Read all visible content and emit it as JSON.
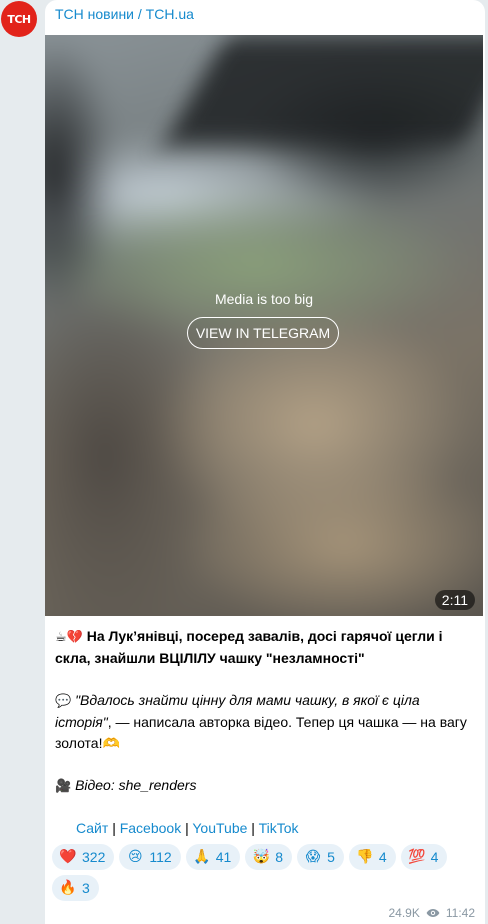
{
  "avatar": {
    "text": "TCH"
  },
  "channel": {
    "name": "ТСН новини / TCH.ua"
  },
  "media": {
    "message": "Media is too big",
    "button_label": "VIEW IN TELEGRAM",
    "duration": "2:11"
  },
  "post": {
    "headline_emoji": "☕💔",
    "headline": "На Лук’янівці, посеред завалів, досі гарячої цегли і скла, знайшли ВЦІЛІЛУ чашку \"незламності\"",
    "quote_emoji": "💬",
    "quote_italic": "\"Вдалось знайти цінну для мами чашку, в якої є ціла історія\"",
    "quote_rest": ", — написала авторка відео. Тепер ця чашка — на вагу золота!🫶",
    "video_emoji": "🎥",
    "video_credit": "Відео: she_renders",
    "links": [
      {
        "label": "Сайт"
      },
      {
        "label": "Facebook"
      },
      {
        "label": "YouTube"
      },
      {
        "label": "TikTok"
      }
    ],
    "link_separator": "|"
  },
  "reactions": [
    {
      "icon": "red-heart",
      "glyph": "❤️",
      "count": "322"
    },
    {
      "icon": "crying-face",
      "glyph": "😢",
      "count": "112"
    },
    {
      "icon": "folded-hands",
      "glyph": "🙏",
      "count": "41"
    },
    {
      "icon": "exploding-head",
      "glyph": "🤯",
      "count": "8"
    },
    {
      "icon": "screaming-face",
      "glyph": "😱",
      "count": "5"
    },
    {
      "icon": "thumbs-down",
      "glyph": "👎",
      "count": "4"
    },
    {
      "icon": "hundred-points",
      "glyph": "💯",
      "count": "4"
    },
    {
      "icon": "fire",
      "glyph": "🔥",
      "count": "3"
    }
  ],
  "footer": {
    "views": "24.9K",
    "time": "11:42"
  },
  "colors": {
    "accent": "#168acd",
    "brand": "#e2231a",
    "background": "#e6ebee"
  }
}
